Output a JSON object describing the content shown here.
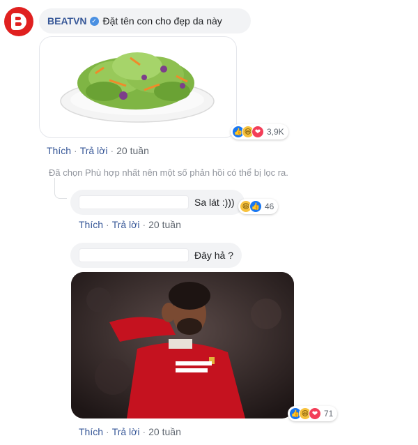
{
  "post": {
    "author": "BEATVN",
    "text": "Đặt tên con cho đẹp da này",
    "reactions_count": "3,9K",
    "actions": {
      "like": "Thích",
      "reply": "Trả lời",
      "time": "20 tuần"
    }
  },
  "filter_note": "Đã chọn Phù hợp nhất nên một số phản hồi có thể bị lọc ra.",
  "replies": [
    {
      "text": "Sa lát :)))",
      "reactions_count": "46",
      "actions": {
        "like": "Thích",
        "reply": "Trả lời",
        "time": "20 tuần"
      }
    },
    {
      "text": "Đây hả ?",
      "reactions_count": "71",
      "actions": {
        "like": "Thích",
        "reply": "Trả lời",
        "time": "20 tuần"
      }
    }
  ],
  "icons": {
    "avatar": "beatvn-logo-icon",
    "verified": "verified-badge-icon",
    "reactions": [
      "like-icon",
      "haha-icon",
      "love-icon"
    ]
  },
  "colors": {
    "link": "#385898",
    "bubble": "#f2f3f5",
    "brand_red": "#e0201f",
    "like_blue": "#1877f2",
    "love_red": "#f33e58"
  }
}
